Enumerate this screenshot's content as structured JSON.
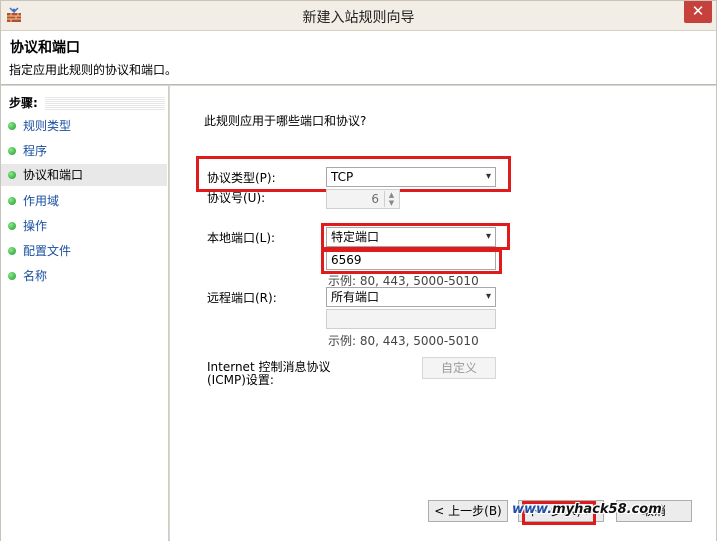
{
  "window": {
    "title": "新建入站规则向导",
    "close_glyph": "✕"
  },
  "header": {
    "title": "协议和端口",
    "description": "指定应用此规则的协议和端口。"
  },
  "sidebar": {
    "heading": "步骤:",
    "steps": [
      {
        "label": "规则类型"
      },
      {
        "label": "程序"
      },
      {
        "label": "协议和端口"
      },
      {
        "label": "作用域"
      },
      {
        "label": "操作"
      },
      {
        "label": "配置文件"
      },
      {
        "label": "名称"
      }
    ],
    "current_index": 2
  },
  "form": {
    "question": "此规则应用于哪些端口和协议?",
    "protocol_type_label": "协议类型(P):",
    "protocol_type_value": "TCP",
    "protocol_number_label": "协议号(U):",
    "protocol_number_value": "6",
    "local_port_label": "本地端口(L):",
    "local_port_mode": "特定端口",
    "local_port_value": "6569",
    "local_example": "示例: 80, 443, 5000-5010",
    "remote_port_label": "远程端口(R):",
    "remote_port_mode": "所有端口",
    "remote_port_value": "",
    "remote_example": "示例: 80, 443, 5000-5010",
    "icmp_label": "Internet 控制消息协议(ICMP)设置:",
    "customize_button": "自定义"
  },
  "footer": {
    "back_button": "< 上一步(B)",
    "next_button": "下一步(N) >",
    "cancel_button": "取消"
  },
  "watermark": {
    "prefix": "www.",
    "middle": "myhack58",
    "suffix": ".com"
  },
  "colors": {
    "highlight": "#e01b1b",
    "step_link": "#1a4fa0",
    "close_button": "#c7413c"
  }
}
